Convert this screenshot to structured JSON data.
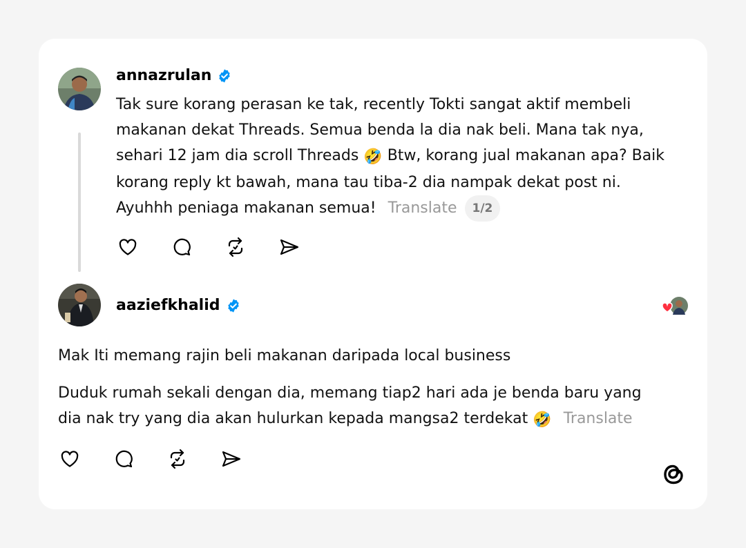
{
  "post1": {
    "username": "annazrulan",
    "text_lines": [
      "Tak sure korang perasan ke tak, recently Tokti sangat aktif membeli",
      "makanan dekat Threads. Semua benda la dia nak beli. Mana tak nya,",
      "sehari 12 jam dia scroll Threads",
      "Btw, korang jual makanan apa? Baik",
      "korang reply kt bawah, mana tau tiba-2 dia nampak dekat post ni.",
      "Ayuhhh peniaga makanan semua!"
    ],
    "emoji": "🤣",
    "translate_label": "Translate",
    "page_indicator": "1/2"
  },
  "post2": {
    "username": "aaziefkhalid",
    "paragraph1": "Mak Iti memang rajin beli makanan daripada local business",
    "paragraph2_line1": "Duduk rumah sekali dengan dia, memang tiap2 hari ada je benda baru yang",
    "paragraph2_line2": "dia nak try yang dia akan hulurkan kepada mangsa2 terdekat",
    "emoji": "🤣",
    "translate_label": "Translate"
  },
  "icons": [
    "heart-icon",
    "comment-icon",
    "repost-icon",
    "share-icon",
    "verified-icon",
    "threads-logo-icon"
  ],
  "colors": {
    "background": "#f5f5f5",
    "card": "#ffffff",
    "verified": "#0095f6",
    "muted": "#999999",
    "like_heart": "#ff3040"
  }
}
